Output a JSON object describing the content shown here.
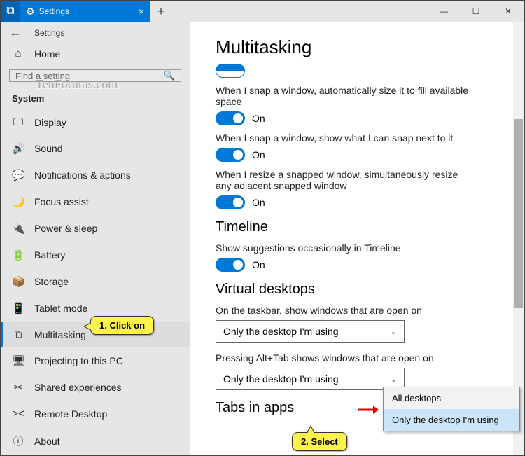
{
  "titlebar": {
    "tab_label": "Settings"
  },
  "sidebar": {
    "back_title": "Settings",
    "home_label": "Home",
    "search_placeholder": "Find a setting",
    "section_label": "System",
    "items": [
      {
        "icon": "🖵",
        "label": "Display"
      },
      {
        "icon": "🔊",
        "label": "Sound"
      },
      {
        "icon": "💬",
        "label": "Notifications & actions"
      },
      {
        "icon": "🌙",
        "label": "Focus assist"
      },
      {
        "icon": "🔌",
        "label": "Power & sleep"
      },
      {
        "icon": "🔋",
        "label": "Battery"
      },
      {
        "icon": "📦",
        "label": "Storage"
      },
      {
        "icon": "📱",
        "label": "Tablet mode"
      },
      {
        "icon": "⧉",
        "label": "Multitasking"
      },
      {
        "icon": "🖥",
        "label": "Projecting to this PC"
      },
      {
        "icon": "✂",
        "label": "Shared experiences"
      },
      {
        "icon": "><",
        "label": "Remote Desktop"
      },
      {
        "icon": "ⓘ",
        "label": "About"
      }
    ]
  },
  "content": {
    "page_title": "Multitasking",
    "snap1_text": "When I snap a window, automatically size it to fill available space",
    "snap2_text": "When I snap a window, show what I can snap next to it",
    "snap3_text": "When I resize a snapped window, simultaneously resize any adjacent snapped window",
    "on_label": "On",
    "timeline_heading": "Timeline",
    "timeline_text": "Show suggestions occasionally in Timeline",
    "vd_heading": "Virtual desktops",
    "vd_taskbar_text": "On the taskbar, show windows that are open on",
    "vd_taskbar_value": "Only the desktop I'm using",
    "vd_alttab_text": "Pressing Alt+Tab shows windows that are open on",
    "vd_alttab_value": "Only the desktop I'm using",
    "tabs_heading": "Tabs in apps"
  },
  "popup": {
    "opt1": "All desktops",
    "opt2": "Only the desktop I'm using"
  },
  "callouts": {
    "c1": "1. Click on",
    "c2": "2. Select"
  },
  "watermark": "TenForums.com"
}
